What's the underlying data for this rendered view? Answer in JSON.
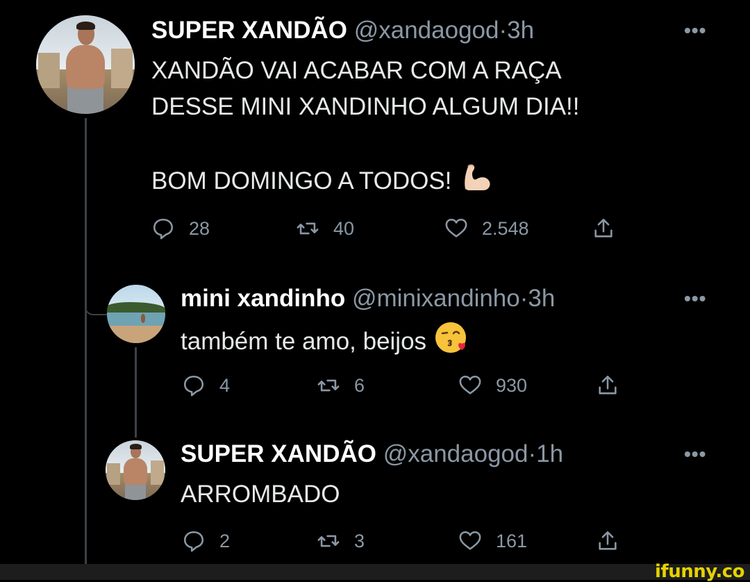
{
  "tweets": [
    {
      "name": "SUPER XANDÃO",
      "handle": "@xandaogod",
      "time": "3h",
      "lines": [
        "XANDÃO VAI ACABAR COM A RAÇA",
        "DESSE MINI XANDINHO ALGUM DIA!!",
        "",
        "BOM DOMINGO A TODOS!"
      ],
      "emoji": "flexed-biceps",
      "replies": "28",
      "retweets": "40",
      "likes": "2.548"
    },
    {
      "name": "mini xandinho",
      "handle": "@minixandinho",
      "time": "3h",
      "lines": [
        "também te amo, beijos"
      ],
      "emoji": "face-blowing-kiss",
      "replies": "4",
      "retweets": "6",
      "likes": "930"
    },
    {
      "name": "SUPER XANDÃO",
      "handle": "@xandaogod",
      "time": "1h",
      "lines": [
        "ARROMBADO"
      ],
      "replies": "2",
      "retweets": "3",
      "likes": "161"
    }
  ],
  "separator": "·",
  "more_label": "•••",
  "watermark": "ifunny.co",
  "colors": {
    "background": "#000000",
    "text": "#e7e9ea",
    "muted": "#8b98a5",
    "line": "#3d4146",
    "brand": "#e6d200"
  }
}
